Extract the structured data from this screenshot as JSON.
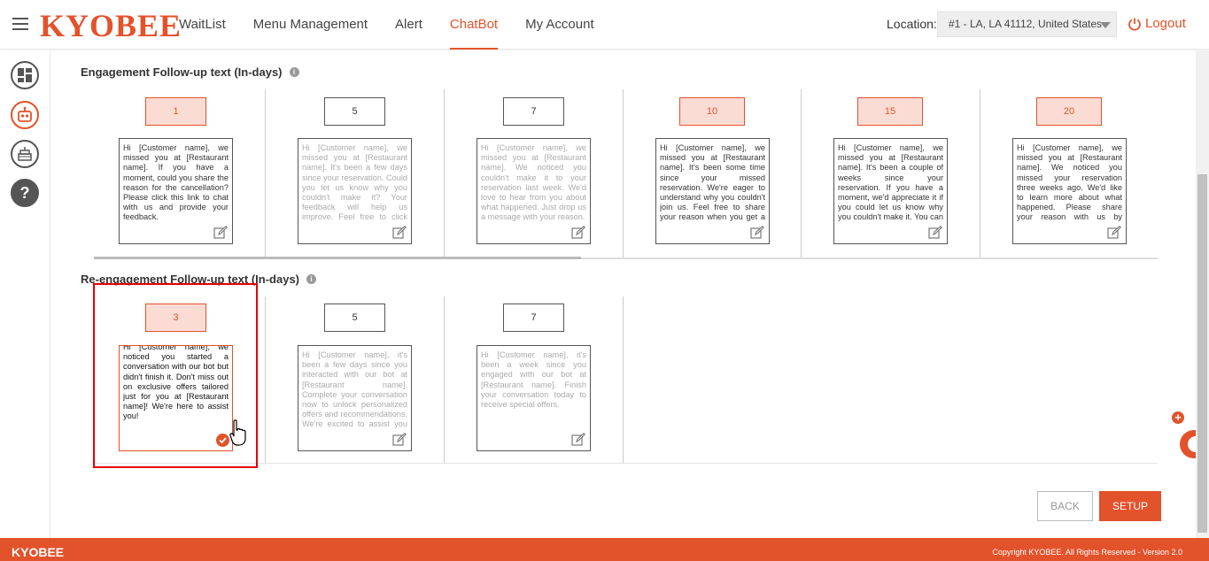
{
  "header": {
    "logo": "KYOBEE",
    "nav": [
      "WaitList",
      "Menu Management",
      "Alert",
      "ChatBot",
      "My Account"
    ],
    "active_nav": "ChatBot",
    "location_label": "Location:",
    "location_value": "#1 - LA, LA 41112, United States",
    "logout_label": "Logout"
  },
  "engagement": {
    "title": "Engagement Follow-up text (In-days)",
    "items": [
      {
        "day": "1",
        "text": "Hi [Customer name], we missed you at [Restaurant name]. If you have a moment, could you share the reason for the cancellation? Please click this link to chat with us and provide your feedback."
      },
      {
        "day": "5",
        "text": "Hi [Customer name], we missed you at [Restaurant name]. It's been a few days since your reservation. Could you let us know why you couldn't make it? Your feedback will help us improve. Feel free to click this link to chat with us."
      },
      {
        "day": "7",
        "text": "Hi [Customer name], we missed you at [Restaurant name]. We noticed you couldn't make it to your reservation last week. We'd love to hear from you about what happened. Just drop us a message with your reason."
      },
      {
        "day": "10",
        "text": "Hi [Customer name], we missed you at [Restaurant name]. It's been some time since your missed reservation. We're eager to understand why you couldn't join us. Feel free to share your reason when you get a chance."
      },
      {
        "day": "15",
        "text": "Hi [Customer name], we missed you at [Restaurant name]. It's been a couple of weeks since your reservation. If you have a moment, we'd appreciate it if you could let us know why you couldn't make it. You can share your reason with us."
      },
      {
        "day": "20",
        "text": "Hi [Customer name], we missed you at [Restaurant name]. We noticed you missed your reservation three weeks ago. We'd like to learn more about what happened. Please share your reason with us by clicking this link to chat."
      }
    ]
  },
  "reengagement": {
    "title": "Re-engagement Follow-up text (In-days)",
    "items": [
      {
        "day": "3",
        "text": "Hi [Customer name], we noticed you started a conversation with our bot but didn't finish it. Don't miss out on exclusive offers tailored just for you at [Restaurant name]! We're here to assist you!"
      },
      {
        "day": "5",
        "text": "Hi [Customer name], it's been a few days since you interacted with our bot at [Restaurant name]. Complete your conversation now to unlock personalized offers and recommendations. We're excited to assist you further!"
      },
      {
        "day": "7",
        "text": "Hi [Customer name], it's been a week since you engaged with our bot at [Restaurant name]. Finish your conversation today to receive special offers."
      }
    ]
  },
  "buttons": {
    "back": "BACK",
    "setup": "SETUP"
  },
  "footer": {
    "logo": "KYOBEE",
    "copyright": "Copyright KYOBEE. All Rights Reserved - Version 2.0"
  },
  "colors": {
    "brand": "#e2522b",
    "highlight_bg": "#fbdcd5",
    "selection_frame": "#e60000"
  }
}
